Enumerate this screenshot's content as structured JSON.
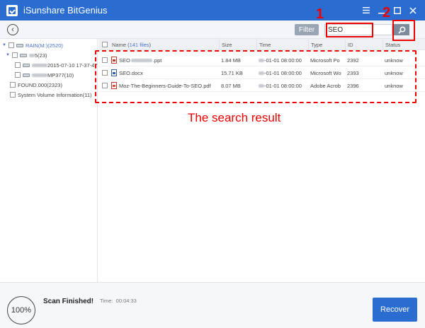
{
  "window": {
    "title": "iSunshare BitGenius",
    "controls": [
      "menu-icon",
      "minimize-icon",
      "maximize-icon",
      "close-icon"
    ]
  },
  "toolbar": {
    "back_icon": "back-arrow-icon",
    "filter_label": "Filter",
    "search_value": "SEO",
    "search_icon": "search-icon"
  },
  "tree": {
    "items": [
      {
        "label": "RAIN(M:)(2520)",
        "level": 0,
        "expanded": true
      },
      {
        "label": "5(23)",
        "level": 1,
        "expanded": true
      },
      {
        "label": "2015-07-10 17-37-47)(",
        "level": 2
      },
      {
        "label": "MP377(10)",
        "level": 2
      },
      {
        "label": "FOUND.000(2323)",
        "level": 1
      },
      {
        "label": "System Volume Information(11)",
        "level": 1
      }
    ]
  },
  "table": {
    "columns": {
      "name_prefix": "Name (",
      "name_count": "141 files",
      "name_suffix": " )",
      "size": "Size",
      "time": "Time",
      "type": "Type",
      "id": "ID",
      "status": "Status"
    },
    "rows": [
      {
        "name_prefix": "SEO",
        "name_suffix": ".ppt",
        "size": "1.84 MB",
        "time": "-01-01 08:00:00",
        "type": "Microsoft Po",
        "id": "2392",
        "status": "unknow",
        "icon": "ppt"
      },
      {
        "name_prefix": "SEO.docx",
        "name_suffix": "",
        "size": "15.71 KB",
        "time": "-01-01 08:00:00",
        "type": "Microsoft Wo",
        "id": "2393",
        "status": "unknow",
        "icon": "docx"
      },
      {
        "name_prefix": "Moz-The-Beginners-Guide-To-SEO.pdf",
        "name_suffix": "",
        "size": "8.07 MB",
        "time": "-01-01 08:00:00",
        "type": "Adobe Acrob",
        "id": "2396",
        "status": "unknow",
        "icon": "pdf"
      }
    ]
  },
  "annotations": {
    "num1": "1",
    "num2": "2",
    "caption": "The search result",
    "color": "#e00000"
  },
  "footer": {
    "progress": "100%",
    "status": "Scan Finished!",
    "time_label": "Time:",
    "time_value": "00:04:33",
    "recover_label": "Recover"
  },
  "colors": {
    "accent": "#2b6cd0",
    "link": "#4a73c9"
  }
}
